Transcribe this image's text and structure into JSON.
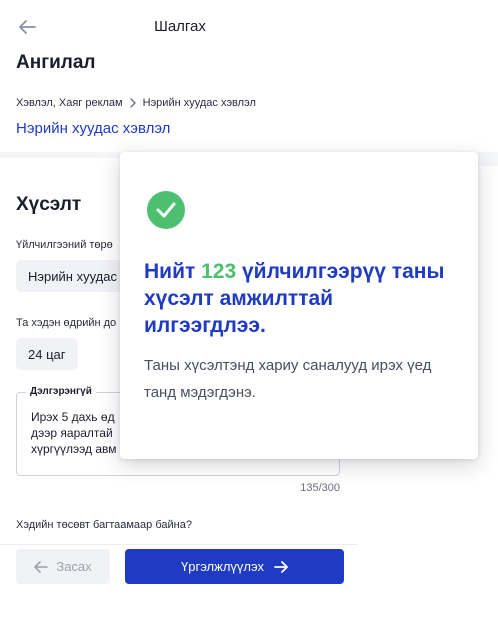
{
  "header": {
    "title": "Шалгах",
    "back_icon": "arrow-left-icon"
  },
  "category": {
    "title": "Ангилал",
    "breadcrumb_parent": "Хэвлэл, Хаяг реклам",
    "breadcrumb_child": "Нэрийн хуудас хэвлэл",
    "selected": "Нэрийн хуудас хэвлэл"
  },
  "request": {
    "title": "Хүсэлт",
    "service_type_label": "Үйлчилгээний төрө",
    "service_type_value": "Нэрийн хуудас",
    "days_label": "Та хэдэн өдрийн до",
    "days_value": "24 цаг",
    "details_label": "Дэлгэрэнгүй",
    "details_text": "Ирэх 5 дахь өд\nдээр яаралтай\nхүргүүлээд авм",
    "char_counter": "135/300",
    "budget_question": "Хэдийн төсөвт багтаамаар байна?"
  },
  "actions": {
    "edit_label": "Засах",
    "continue_label": "Үргэлжлүүлэх"
  },
  "modal": {
    "title_prefix": "Нийт ",
    "count": "123",
    "title_suffix": " үйлчилгээрүү таны хүсэлт амжилттай илгээгдлээ.",
    "body": "Таны хүсэлтэнд хариу саналууд ирэх үед танд мэдэгдэнэ.",
    "icon": "check-circle-icon"
  },
  "colors": {
    "primary": "#1f3bc4",
    "success": "#4cc06f",
    "muted": "#9da1ad"
  }
}
